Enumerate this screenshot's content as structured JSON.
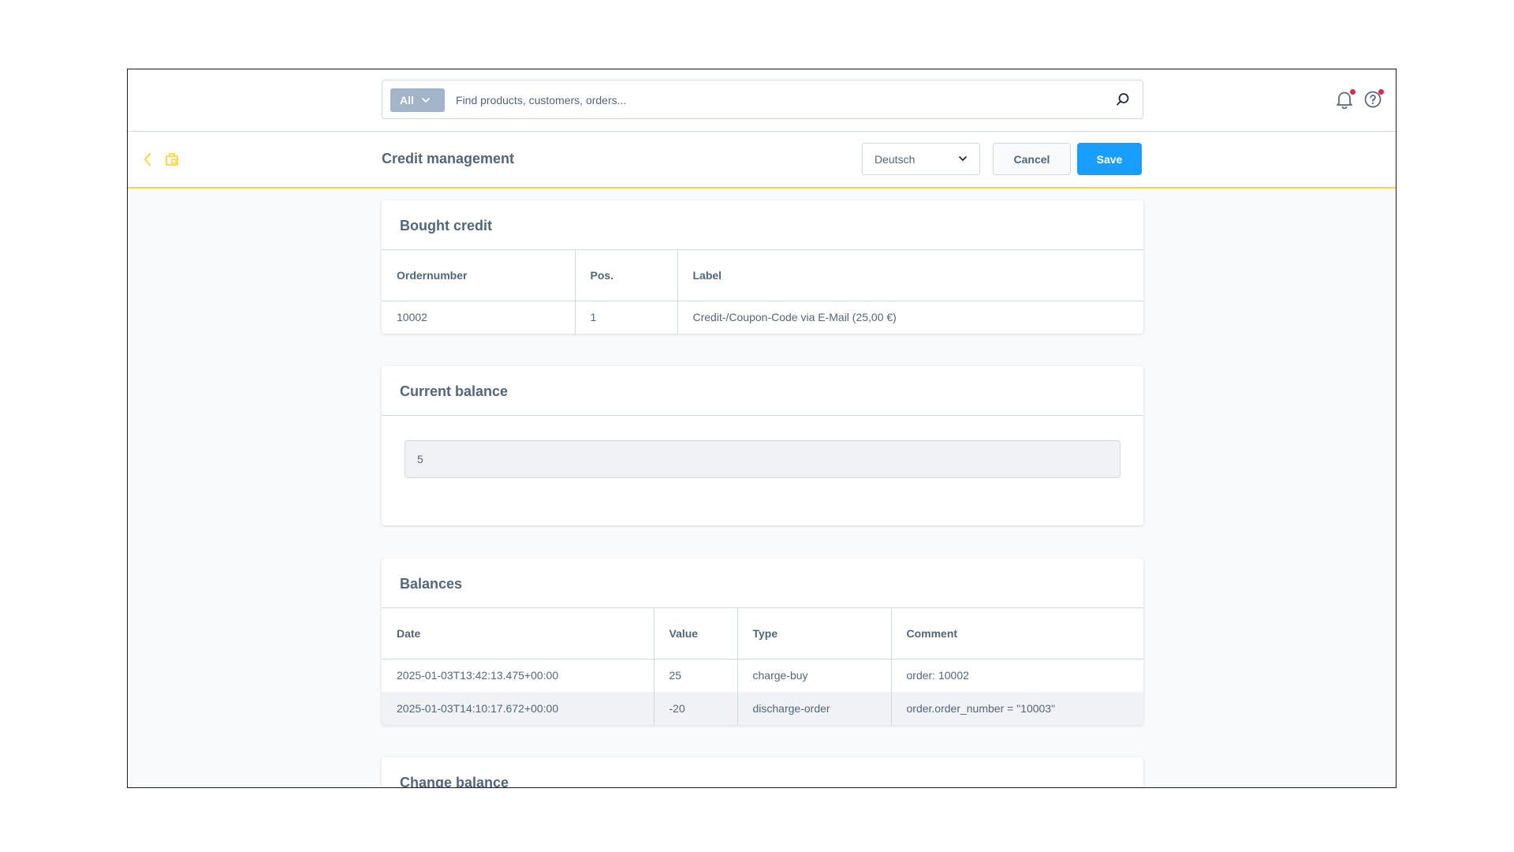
{
  "search": {
    "type_label": "All",
    "placeholder": "Find products, customers, orders...",
    "value": ""
  },
  "header": {
    "title": "Credit management",
    "language": "Deutsch",
    "cancel_label": "Cancel",
    "save_label": "Save"
  },
  "bought_credit": {
    "title": "Bought credit",
    "columns": [
      "Ordernumber",
      "Pos.",
      "Label"
    ],
    "rows": [
      [
        "10002",
        "1",
        "Credit-/Coupon-Code via E-Mail (25,00 €)"
      ]
    ]
  },
  "current_balance": {
    "title": "Current balance",
    "value": "5"
  },
  "balances": {
    "title": "Balances",
    "columns": [
      "Date",
      "Value",
      "Type",
      "Comment"
    ],
    "rows": [
      [
        "2025-01-03T13:42:13.475+00:00",
        "25",
        "charge-buy",
        "order: 10002"
      ],
      [
        "2025-01-03T14:10:17.672+00:00",
        "-20",
        "discharge-order",
        "order.order_number = \"10003\""
      ]
    ]
  },
  "change_balance": {
    "title": "Change balance"
  },
  "colors": {
    "accent": "#189eff",
    "smartbar_border": "#ffd440",
    "notification_dot": "#de294c"
  },
  "icons": [
    "chevron-down-icon",
    "search-icon",
    "bell-icon",
    "help-icon",
    "back-arrow-icon",
    "module-icon"
  ]
}
